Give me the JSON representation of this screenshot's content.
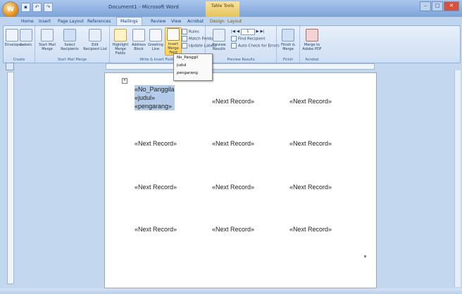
{
  "title_bar": {
    "document_title": "Document1 - Microsoft Word",
    "context_tab_header": "Table Tools",
    "office_button_icon": "office-logo-icon"
  },
  "tabs": [
    "Home",
    "Insert",
    "Page Layout",
    "References",
    "Mailings",
    "Review",
    "View",
    "Acrobat",
    "Design",
    "Layout"
  ],
  "active_tab": "Mailings",
  "ribbon": {
    "groups": [
      {
        "label": "Create",
        "buttons": [
          "Envelopes",
          "Labels"
        ]
      },
      {
        "label": "Start Mail Merge",
        "buttons": [
          "Start Mail Merge",
          "Select Recipients",
          "Edit Recipient List"
        ]
      },
      {
        "label": "Write & Insert Fields",
        "buttons": [
          "Highlight Merge Fields",
          "Address Block",
          "Greeting Line",
          "Insert Merge Field"
        ],
        "small": [
          "Rules",
          "Match Fields",
          "Update Labels"
        ]
      },
      {
        "label": "Preview Results",
        "buttons": [
          "Preview Results"
        ],
        "small": [
          "1",
          "Find Recipient",
          "Auto Check for Errors"
        ]
      },
      {
        "label": "Finish",
        "buttons": [
          "Finish & Merge"
        ]
      },
      {
        "label": "Acrobat",
        "buttons": [
          "Merge to Adobe PDF"
        ]
      }
    ]
  },
  "insert_merge_field_menu": [
    "No_Panggil",
    "judul",
    "pengarang"
  ],
  "document": {
    "first_cell_fields": [
      "«No_Panggila",
      "«judul»",
      "«pengarang»"
    ],
    "next_record": "«Next Record»"
  }
}
